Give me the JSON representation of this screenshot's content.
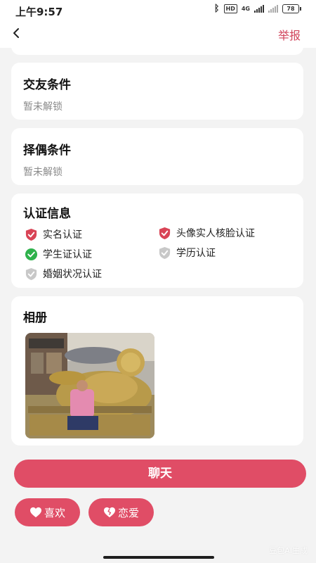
{
  "status_bar": {
    "time": "上午9:57",
    "network": "4G",
    "battery": "78"
  },
  "nav": {
    "report_label": "举报"
  },
  "friend_conditions": {
    "title": "交友条件",
    "value": "暂未解锁"
  },
  "mate_conditions": {
    "title": "择偶条件",
    "value": "暂未解锁"
  },
  "verification": {
    "title": "认证信息",
    "items": [
      {
        "label": "实名认证",
        "status_color": "#d94456"
      },
      {
        "label": "头像实人核脸认证",
        "status_color": "#d94456"
      },
      {
        "label": "学生证认证",
        "status_color": "#2fb24c"
      },
      {
        "label": "学历认证",
        "status_color": "#c8c8c8"
      },
      {
        "label": "婚姻状况认证",
        "status_color": "#c8c8c8"
      }
    ]
  },
  "album": {
    "title": "相册"
  },
  "actions": {
    "chat_label": "聊天",
    "like_label": "喜欢",
    "love_label": "恋爱"
  },
  "watermark": "豆包AI生成",
  "colors": {
    "accent": "#e04d66",
    "report": "#d0435a"
  }
}
